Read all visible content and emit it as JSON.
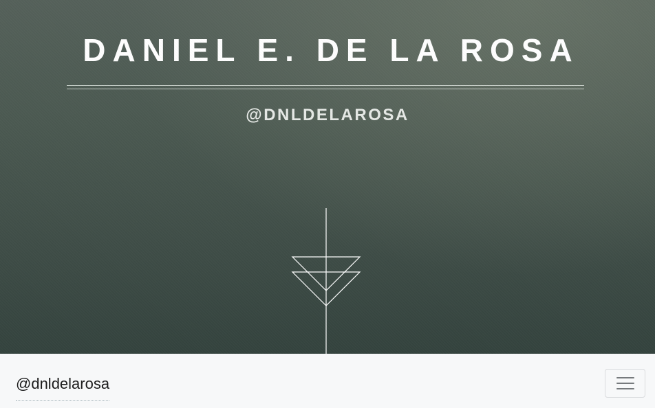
{
  "header": {
    "title": "DANIEL E. DE LA ROSA",
    "handle": "@DNLDELAROSA",
    "emblem_icon": "arrow-triangle-emblem-icon",
    "colors": {
      "text": "#ffffff",
      "subtitle": "#e6e9e6",
      "background_top": "#55615a",
      "background_bottom": "#34433e"
    }
  },
  "navbar": {
    "brand_label": "@dnldelarosa",
    "menu_icon": "hamburger-menu-icon",
    "colors": {
      "background": "#f7f8f9",
      "brand": "#1c1c1c"
    }
  }
}
